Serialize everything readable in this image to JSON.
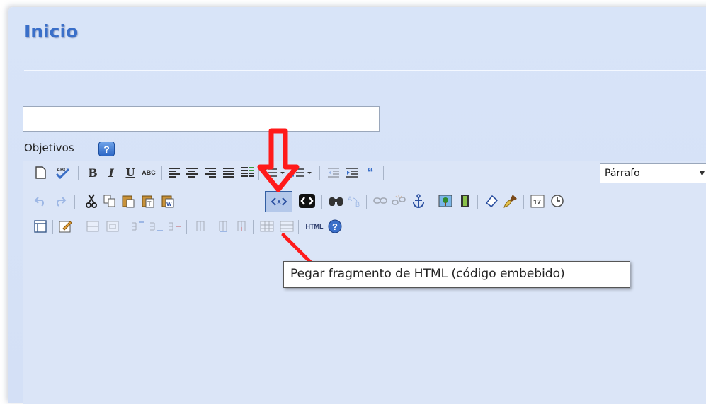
{
  "page": {
    "title": "Inicio"
  },
  "form": {
    "title_field_value": "",
    "objectives_label": "Objetivos",
    "help_glyph": "?"
  },
  "toolbar": {
    "format_value": "Párrafo",
    "format_arrow": "▾",
    "html_plain_label": "HTML",
    "tooltip": "Pegar fragmento de HTML (código embebido)",
    "icons": [
      "new-document-icon",
      "spellcheck-icon",
      "bold-icon",
      "italic-icon",
      "underline-icon",
      "strikethrough-icon",
      "align-left-icon",
      "align-center-icon",
      "align-right-icon",
      "align-justify-icon",
      "style-icon",
      "bulleted-list-icon",
      "numbered-list-icon",
      "outdent-icon",
      "indent-icon",
      "blockquote-icon",
      "undo-icon",
      "redo-icon",
      "cut-icon",
      "copy-icon",
      "paste-icon",
      "paste-text-icon",
      "paste-word-icon",
      "insert-html-snippet-icon",
      "embed-media-icon",
      "find-icon",
      "replace-icon",
      "link-icon",
      "unlink-icon",
      "anchor-icon",
      "image-icon",
      "media-icon",
      "eraser-icon",
      "cleanup-icon",
      "date-icon",
      "time-icon",
      "table-icon",
      "edit-table-icon",
      "split-cells-icon",
      "merge-cells-icon",
      "row-before-icon",
      "row-after-icon",
      "row-delete-icon",
      "column-before-icon",
      "column-after-icon",
      "column-delete-icon",
      "cell-props-icon",
      "row-props-icon",
      "html-source-icon",
      "help-icon"
    ]
  },
  "colors": {
    "panel_bg": "#d8e4f8",
    "title_color": "#3a6fc9",
    "annotation_red": "#ff1a1a"
  }
}
